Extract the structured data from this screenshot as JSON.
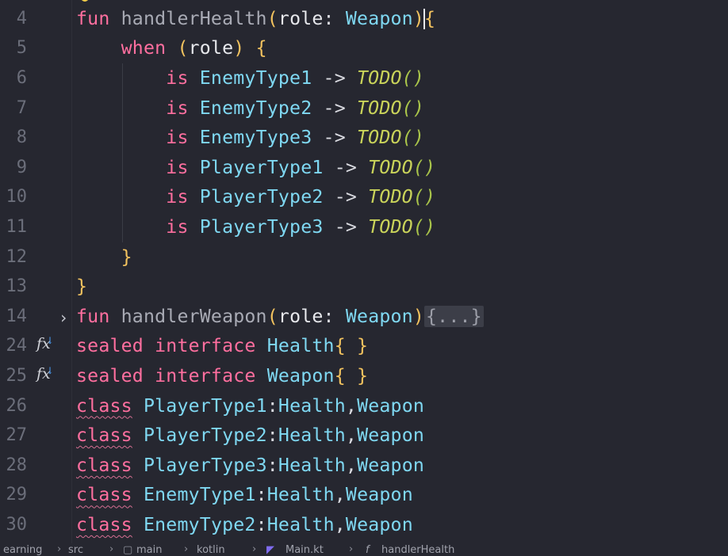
{
  "editor": {
    "lines": [
      {
        "num": "4",
        "parts": [
          {
            "t": "fun ",
            "c": "kwfun"
          },
          {
            "t": "handlerHealth",
            "c": "fn"
          },
          {
            "t": "(",
            "c": "brace"
          },
          {
            "t": "role",
            "c": "param"
          },
          {
            "t": ": ",
            "c": "op"
          },
          {
            "t": "Weapon",
            "c": "type"
          },
          {
            "t": ")",
            "c": "brace"
          },
          {
            "t": "CURSOR",
            "c": "cursor"
          },
          {
            "t": "{",
            "c": "brace"
          }
        ]
      },
      {
        "num": "5",
        "parts": [
          {
            "t": "    when ",
            "c": "kw"
          },
          {
            "t": "(",
            "c": "brace"
          },
          {
            "t": "role",
            "c": "param"
          },
          {
            "t": ")",
            "c": "brace"
          },
          {
            "t": " {",
            "c": "brace"
          }
        ]
      },
      {
        "num": "6",
        "parts": [
          {
            "t": "        is ",
            "c": "kw"
          },
          {
            "t": "EnemyType1",
            "c": "type"
          },
          {
            "t": " -> ",
            "c": "op"
          },
          {
            "t": "TODO",
            "c": "todo"
          },
          {
            "t": "()",
            "c": "paren-todo"
          }
        ]
      },
      {
        "num": "7",
        "parts": [
          {
            "t": "        is ",
            "c": "kw"
          },
          {
            "t": "EnemyType2",
            "c": "type"
          },
          {
            "t": " -> ",
            "c": "op"
          },
          {
            "t": "TODO",
            "c": "todo"
          },
          {
            "t": "()",
            "c": "paren-todo"
          }
        ]
      },
      {
        "num": "8",
        "parts": [
          {
            "t": "        is ",
            "c": "kw"
          },
          {
            "t": "EnemyType3",
            "c": "type"
          },
          {
            "t": " -> ",
            "c": "op"
          },
          {
            "t": "TODO",
            "c": "todo"
          },
          {
            "t": "()",
            "c": "paren-todo"
          }
        ]
      },
      {
        "num": "9",
        "parts": [
          {
            "t": "        is ",
            "c": "kw"
          },
          {
            "t": "PlayerType1",
            "c": "type"
          },
          {
            "t": " -> ",
            "c": "op"
          },
          {
            "t": "TODO",
            "c": "todo"
          },
          {
            "t": "()",
            "c": "paren-todo"
          }
        ]
      },
      {
        "num": "10",
        "parts": [
          {
            "t": "        is ",
            "c": "kw"
          },
          {
            "t": "PlayerType2",
            "c": "type"
          },
          {
            "t": " -> ",
            "c": "op"
          },
          {
            "t": "TODO",
            "c": "todo"
          },
          {
            "t": "()",
            "c": "paren-todo"
          }
        ]
      },
      {
        "num": "11",
        "parts": [
          {
            "t": "        is ",
            "c": "kw"
          },
          {
            "t": "PlayerType3",
            "c": "type"
          },
          {
            "t": " -> ",
            "c": "op"
          },
          {
            "t": "TODO",
            "c": "todo"
          },
          {
            "t": "()",
            "c": "paren-todo"
          }
        ]
      },
      {
        "num": "12",
        "parts": [
          {
            "t": "    }",
            "c": "brace"
          }
        ]
      },
      {
        "num": "13",
        "parts": [
          {
            "t": "}",
            "c": "brace"
          }
        ]
      },
      {
        "num": "14",
        "fold": "›",
        "parts": [
          {
            "t": "fun ",
            "c": "kwfun"
          },
          {
            "t": "handlerWeapon",
            "c": "fn"
          },
          {
            "t": "(",
            "c": "brace"
          },
          {
            "t": "role",
            "c": "param"
          },
          {
            "t": ": ",
            "c": "op"
          },
          {
            "t": "Weapon",
            "c": "type"
          },
          {
            "t": ")",
            "c": "brace"
          },
          {
            "t": "{...}",
            "c": "folded"
          }
        ]
      },
      {
        "num": "24",
        "fx": true,
        "parts": [
          {
            "t": "sealed interface ",
            "c": "kw"
          },
          {
            "t": "Health",
            "c": "type"
          },
          {
            "t": "{ }",
            "c": "brace"
          }
        ]
      },
      {
        "num": "25",
        "fx": true,
        "parts": [
          {
            "t": "sealed interface ",
            "c": "kw"
          },
          {
            "t": "Weapon",
            "c": "type"
          },
          {
            "t": "{ }",
            "c": "brace"
          }
        ]
      },
      {
        "num": "26",
        "parts": [
          {
            "t": "class",
            "c": "kw squig"
          },
          {
            "t": " ",
            "c": "op"
          },
          {
            "t": "PlayerType1",
            "c": "type"
          },
          {
            "t": ":",
            "c": "op"
          },
          {
            "t": "Health",
            "c": "type"
          },
          {
            "t": ",",
            "c": "op"
          },
          {
            "t": "Weapon",
            "c": "type"
          }
        ]
      },
      {
        "num": "27",
        "parts": [
          {
            "t": "class",
            "c": "kw squig"
          },
          {
            "t": " ",
            "c": "op"
          },
          {
            "t": "PlayerType2",
            "c": "type"
          },
          {
            "t": ":",
            "c": "op"
          },
          {
            "t": "Health",
            "c": "type"
          },
          {
            "t": ",",
            "c": "op"
          },
          {
            "t": "Weapon",
            "c": "type"
          }
        ]
      },
      {
        "num": "28",
        "parts": [
          {
            "t": "class",
            "c": "kw squig"
          },
          {
            "t": " ",
            "c": "op"
          },
          {
            "t": "PlayerType3",
            "c": "type"
          },
          {
            "t": ":",
            "c": "op"
          },
          {
            "t": "Health",
            "c": "type"
          },
          {
            "t": ",",
            "c": "op"
          },
          {
            "t": "Weapon",
            "c": "type"
          }
        ]
      },
      {
        "num": "29",
        "parts": [
          {
            "t": "class",
            "c": "kw squig"
          },
          {
            "t": " ",
            "c": "op"
          },
          {
            "t": "EnemyType1",
            "c": "type"
          },
          {
            "t": ":",
            "c": "op"
          },
          {
            "t": "Health",
            "c": "type"
          },
          {
            "t": ",",
            "c": "op"
          },
          {
            "t": "Weapon",
            "c": "type"
          }
        ]
      },
      {
        "num": "30",
        "parts": [
          {
            "t": "class",
            "c": "kw squig"
          },
          {
            "t": " ",
            "c": "op"
          },
          {
            "t": "EnemyType2",
            "c": "type"
          },
          {
            "t": ":",
            "c": "op"
          },
          {
            "t": "Health",
            "c": "type"
          },
          {
            "t": ",",
            "c": "op"
          },
          {
            "t": "Weapon",
            "c": "type"
          }
        ]
      }
    ]
  },
  "breadcrumb": {
    "items": [
      "earning",
      "src",
      "main",
      "kotlin",
      "Main.kt",
      "handlerHealth"
    ],
    "icons": [
      "",
      "",
      "module-icon",
      "",
      "kotlin-file-icon",
      "function-icon"
    ]
  },
  "colors": {
    "background": "#262730",
    "keyword": "#ff6f9f",
    "type": "#7fd8f2",
    "brace": "#f3c35f",
    "todo": "#c9d35a"
  }
}
